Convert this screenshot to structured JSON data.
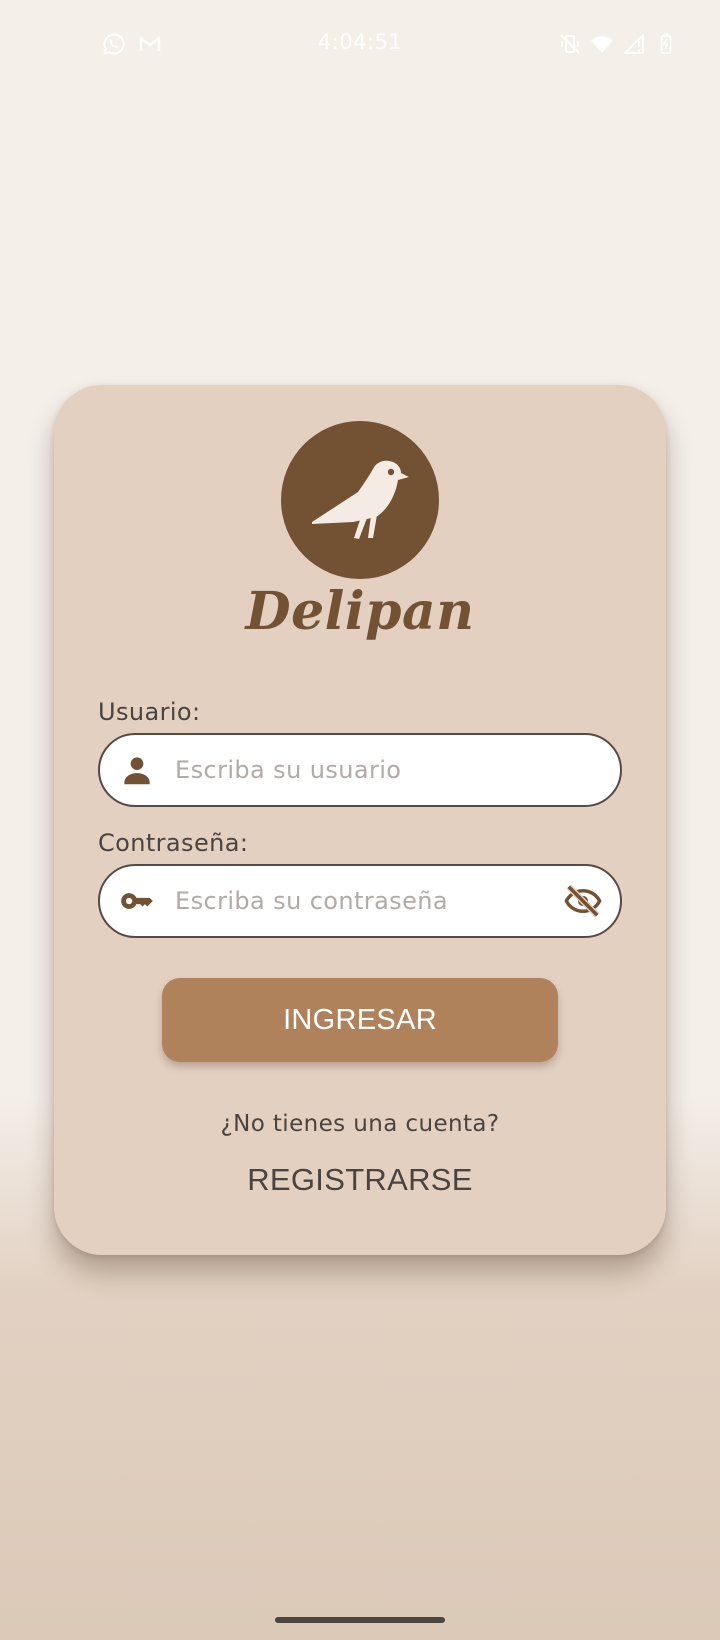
{
  "status_bar": {
    "time": "4:04:51",
    "left_icons": [
      "whatsapp-icon",
      "gmail-icon"
    ],
    "right_icons": [
      "vibrate-off-icon",
      "wifi-icon",
      "signal-icon",
      "battery-icon"
    ]
  },
  "login": {
    "brand_name": "Delipan",
    "username_label": "Usuario:",
    "username_placeholder": "Escriba su usuario",
    "password_label": "Contraseña:",
    "password_placeholder": "Escriba su contraseña",
    "submit_label": "INGRESAR",
    "no_account_text": "¿No tienes una cuenta?",
    "register_label": "REGISTRARSE"
  },
  "colors": {
    "background_top": "#f4efe9",
    "background_bottom": "#dcc9b8",
    "card": "#e3d0c1",
    "brand_brown": "#735233",
    "button": "#b0825b",
    "text": "#4a4340",
    "placeholder": "#b1aaa5"
  },
  "icons": {
    "logo": "bird-icon",
    "username": "person-icon",
    "password": "key-icon",
    "password_toggle": "eye-off-icon"
  }
}
